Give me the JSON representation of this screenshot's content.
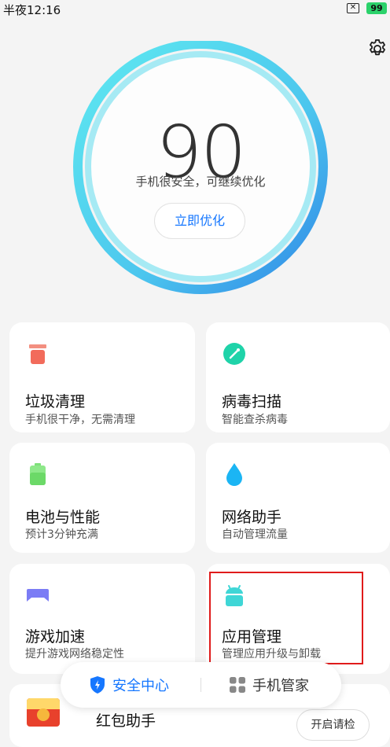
{
  "status": {
    "time": "半夜12:16",
    "sim_label": "✕",
    "battery": "99"
  },
  "score": {
    "value": "90",
    "subtitle": "手机很安全，可继续优化",
    "button": "立即优化"
  },
  "cards": [
    {
      "title": "垃圾清理",
      "sub": "手机很干净，无需清理",
      "icon": "trash-icon",
      "color": "#f26b5b"
    },
    {
      "title": "病毒扫描",
      "sub": "智能查杀病毒",
      "icon": "virus-scan-icon",
      "color": "#1fd3a9"
    },
    {
      "title": "电池与性能",
      "sub": "预计3分钟充满",
      "icon": "battery-icon",
      "color": "#7ee07a"
    },
    {
      "title": "网络助手",
      "sub": "自动管理流量",
      "icon": "water-drop-icon",
      "color": "#1bb5f4"
    },
    {
      "title": "游戏加速",
      "sub": "提升游戏网络稳定性",
      "icon": "gamepad-icon",
      "color": "#7b7cf5"
    },
    {
      "title": "应用管理",
      "sub": "管理应用升级与卸载",
      "icon": "android-icon",
      "color": "#3fd6d6"
    }
  ],
  "redpacket": {
    "title": "红包助手",
    "button": "开启请检"
  },
  "tabs": {
    "security": "安全中心",
    "manager": "手机管家"
  },
  "colors": {
    "accent": "#1677ff",
    "ring_start": "#4fe3ee",
    "ring_end": "#2f8fe8",
    "highlight": "#e01b1b"
  }
}
